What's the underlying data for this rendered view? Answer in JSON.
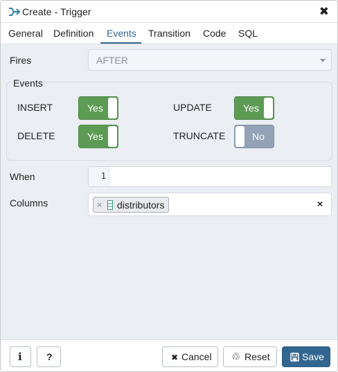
{
  "window": {
    "title": "Create - Trigger",
    "title_icon": "trigger-icon",
    "close_glyph": "✖"
  },
  "tabs": [
    {
      "label": "General",
      "active": false
    },
    {
      "label": "Definition",
      "active": false
    },
    {
      "label": "Events",
      "active": true
    },
    {
      "label": "Transition",
      "active": false
    },
    {
      "label": "Code",
      "active": false
    },
    {
      "label": "SQL",
      "active": false
    }
  ],
  "form": {
    "fires": {
      "label": "Fires",
      "value": "AFTER"
    },
    "events": {
      "legend": "Events",
      "insert": {
        "label": "INSERT",
        "state": "Yes",
        "on": true
      },
      "update": {
        "label": "UPDATE",
        "state": "Yes",
        "on": true
      },
      "delete": {
        "label": "DELETE",
        "state": "Yes",
        "on": true
      },
      "truncate": {
        "label": "TRUNCATE",
        "state": "No",
        "on": false
      }
    },
    "when": {
      "label": "When",
      "line_number": "1",
      "value": ""
    },
    "columns": {
      "label": "Columns",
      "chips": [
        {
          "text": "distributors",
          "remove_glyph": "×",
          "icon": "column-icon"
        }
      ],
      "clear_glyph": "×"
    }
  },
  "footer": {
    "info_glyph": "i",
    "help_glyph": "?",
    "cancel": {
      "glyph": "✖",
      "label": "Cancel"
    },
    "reset": {
      "glyph": "♲",
      "label": "Reset"
    },
    "save": {
      "glyph": "💾",
      "label": "Save"
    }
  },
  "colors": {
    "accent": "#326690",
    "toggle_on": "#5d9b55",
    "toggle_off": "#93a2b6",
    "panel_bg": "#ebeef3"
  }
}
